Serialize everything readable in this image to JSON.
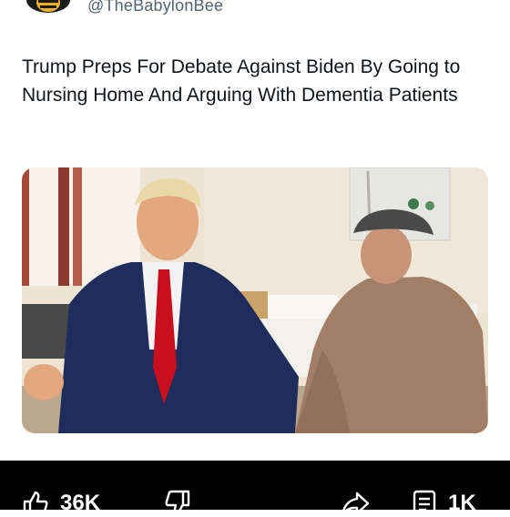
{
  "post": {
    "handle": "@TheBabylonBee",
    "headline": "Trump Preps For Debate Against Biden By Going to Nursing Home And Arguing With Dementia Patients"
  },
  "actions": {
    "like_count": "36K",
    "views_count": "1K"
  },
  "icons": [
    "bee-logo-icon",
    "thumbs-up-icon",
    "thumbs-down-icon",
    "share-icon",
    "document-icon"
  ],
  "colors": {
    "handle": "#536471",
    "text": "#0f1419",
    "action_bar": "#000000"
  }
}
